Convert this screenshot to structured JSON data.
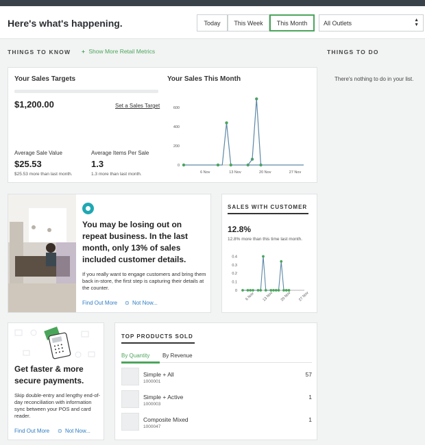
{
  "header": {
    "title": "Here's what's happening.",
    "ranges": [
      "Today",
      "This Week",
      "This Month"
    ],
    "active_range": "This Month",
    "outlet": "All Outlets"
  },
  "things_to_know": {
    "heading": "THINGS TO KNOW",
    "more_link": "Show More Retail Metrics"
  },
  "things_to_do": {
    "heading": "THINGS TO DO",
    "empty_text": "There's nothing to do in your list."
  },
  "sales_targets": {
    "title": "Your Sales Targets",
    "amount": "$1,200.00",
    "set_target_link": "Set a Sales Target",
    "avg_sale_label": "Average Sale Value",
    "avg_sale_value": "$25.53",
    "avg_sale_note": "$25.53 more than last month.",
    "avg_items_label": "Average Items Per Sale",
    "avg_items_value": "1.3",
    "avg_items_note": "1.3 more than last month."
  },
  "sales_month": {
    "title": "Your Sales This Month"
  },
  "repeat_business": {
    "headline": "You may be losing out on repeat business. In the last month, only 13% of sales included customer details.",
    "body": "If you really want to engage customers and bring them back in-store, the first step is capturing their details at the counter.",
    "find_out_more": "Find Out More",
    "not_now": "Not Now..."
  },
  "sales_with_customer": {
    "heading": "SALES WITH CUSTOMER",
    "percent": "12.8%",
    "note": "12.8% more than this time last month."
  },
  "payments": {
    "headline": "Get faster & more secure payments.",
    "body": "Skip double-entry and lengthy end-of-day reconciliation with information sync between your POS and card reader.",
    "find_out_more": "Find Out More",
    "not_now": "Not Now..."
  },
  "top_products": {
    "heading": "TOP PRODUCTS SOLD",
    "tabs": [
      "By Quantity",
      "By Revenue"
    ],
    "active_tab": "By Quantity",
    "rows": [
      {
        "name": "Simple + All",
        "sku": "1000001",
        "qty": "57"
      },
      {
        "name": "Simple + Active",
        "sku": "1000003",
        "qty": "1"
      },
      {
        "name": "Composite Mixed",
        "sku": "1000047",
        "qty": "1"
      }
    ]
  },
  "chart_data": [
    {
      "type": "line",
      "title": "Your Sales This Month",
      "x": [
        "1 Nov",
        "2 Nov",
        "3 Nov",
        "4 Nov",
        "5 Nov",
        "6 Nov",
        "7 Nov",
        "8 Nov",
        "9 Nov",
        "10 Nov",
        "11 Nov",
        "12 Nov",
        "13 Nov",
        "14 Nov",
        "15 Nov",
        "16 Nov",
        "17 Nov",
        "18 Nov",
        "19 Nov",
        "20 Nov",
        "21 Nov",
        "22 Nov",
        "23 Nov",
        "24 Nov",
        "25 Nov",
        "26 Nov",
        "27 Nov",
        "28 Nov",
        "29 Nov"
      ],
      "values": [
        0,
        0,
        0,
        0,
        0,
        0,
        0,
        0,
        0,
        0,
        440,
        0,
        0,
        0,
        0,
        0,
        0,
        0,
        0,
        0,
        0,
        0,
        0,
        0,
        0,
        0,
        0,
        0,
        0
      ],
      "point_values": [
        {
          "x": "1 Nov",
          "y": 0
        },
        {
          "x": "9 Nov",
          "y": 0
        },
        {
          "x": "11 Nov",
          "y": 440
        },
        {
          "x": "12 Nov",
          "y": 0
        },
        {
          "x": "16 Nov",
          "y": 0
        },
        {
          "x": "17 Nov",
          "y": 60
        },
        {
          "x": "18 Nov",
          "y": 690
        },
        {
          "x": "19 Nov",
          "y": 0
        }
      ],
      "xticks": [
        "6 Nov",
        "13 Nov",
        "20 Nov",
        "27 Nov"
      ],
      "yticks": [
        0,
        200,
        400,
        600
      ],
      "ylim": [
        0,
        700
      ],
      "color": "#5c87a6",
      "point_color": "#4aa55a",
      "grid": false
    },
    {
      "type": "line",
      "title": "SALES WITH CUSTOMER",
      "points": [
        {
          "x": "3 Nov",
          "y": 0
        },
        {
          "x": "5 Nov",
          "y": 0
        },
        {
          "x": "6 Nov",
          "y": 0
        },
        {
          "x": "7 Nov",
          "y": 0
        },
        {
          "x": "9 Nov",
          "y": 0
        },
        {
          "x": "10 Nov",
          "y": 0
        },
        {
          "x": "11 Nov",
          "y": 0.4
        },
        {
          "x": "12 Nov",
          "y": 0
        },
        {
          "x": "14 Nov",
          "y": 0
        },
        {
          "x": "15 Nov",
          "y": 0
        },
        {
          "x": "16 Nov",
          "y": 0
        },
        {
          "x": "17 Nov",
          "y": 0
        },
        {
          "x": "18 Nov",
          "y": 0.34
        },
        {
          "x": "19 Nov",
          "y": 0
        },
        {
          "x": "20 Nov",
          "y": 0
        },
        {
          "x": "21 Nov",
          "y": 0
        }
      ],
      "xticks": [
        "6 Nov",
        "13 Nov",
        "20 Nov",
        "27 Nov"
      ],
      "yticks": [
        0,
        0.1,
        0.2,
        0.3,
        0.4
      ],
      "ylim": [
        0,
        0.42
      ],
      "color": "#5c87a6",
      "point_color": "#4aa55a",
      "grid": false
    }
  ]
}
